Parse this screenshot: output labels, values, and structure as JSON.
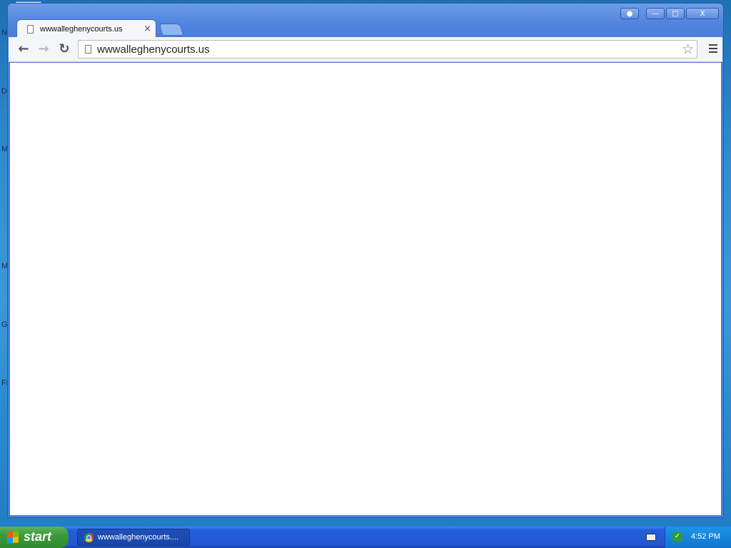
{
  "desktop": {
    "edge_letters": [
      "N",
      "D",
      "M",
      "M",
      "G",
      "Fi"
    ]
  },
  "browser": {
    "tabs": [
      {
        "title": "wwwalleghenycourts.us",
        "close_glyph": "×"
      }
    ],
    "window_controls": {
      "minimize_glyph": "—",
      "maximize_glyph": "□",
      "close_glyph": "X"
    },
    "toolbar": {
      "back_glyph": "←",
      "forward_glyph": "→",
      "reload_glyph": "↻",
      "address": "wwwalleghenycourts.us",
      "bookmark_glyph": "☆"
    },
    "page_content": ""
  },
  "taskbar": {
    "start_label": "start",
    "task_buttons": [
      {
        "label": "wwwalleghenycourts....",
        "icon": "chrome-icon"
      }
    ],
    "clock": "4:52 PM"
  },
  "colors": {
    "window_frame": "#4a7fd8",
    "taskbar": "#245edb",
    "start_button": "#3c9a3a",
    "tray": "#1174cf"
  }
}
